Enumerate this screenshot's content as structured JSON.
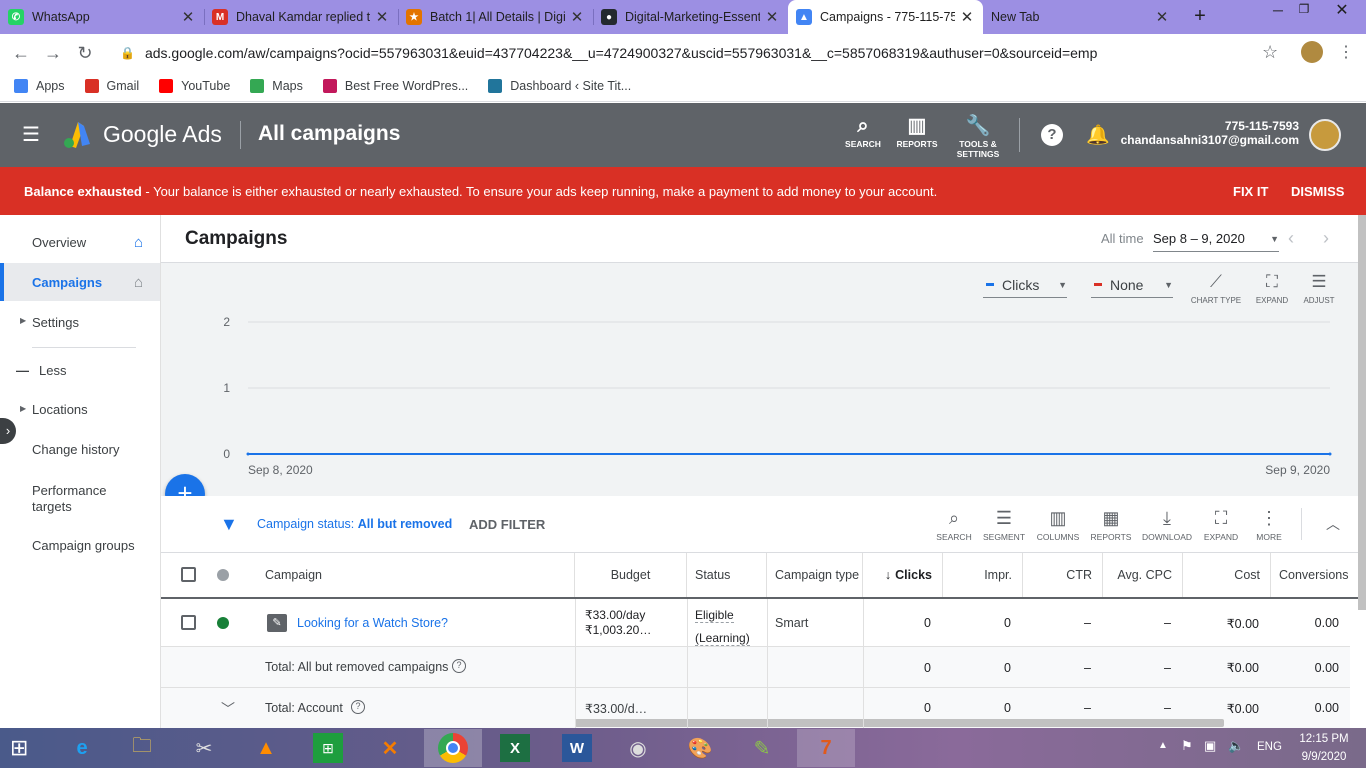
{
  "browser": {
    "tabs": [
      {
        "title": "WhatsApp",
        "color": "#25d366",
        "glyph": "✆"
      },
      {
        "title": "Dhaval Kamdar replied t",
        "color": "#d93025",
        "glyph": "M"
      },
      {
        "title": "Batch 1| All Details | Digi",
        "color": "#e37400",
        "glyph": "★"
      },
      {
        "title": "Digital-Marketing-Essent",
        "color": "#24292e",
        "glyph": "●"
      },
      {
        "title": "Campaigns - 775-115-75",
        "color": "#4285f4",
        "glyph": "▲"
      },
      {
        "title": "New Tab",
        "color": "",
        "glyph": ""
      }
    ],
    "new_tab": "+",
    "url": "ads.google.com/aw/campaigns?ocid=557963031&euid=437704223&__u=4724900327&uscid=557963031&__c=5857068319&authuser=0&sourceid=emp",
    "bookmarks": [
      {
        "label": "Apps",
        "color": "#4285f4"
      },
      {
        "label": "Gmail",
        "color": "#d93025"
      },
      {
        "label": "YouTube",
        "color": "#ff0000"
      },
      {
        "label": "Maps",
        "color": "#34a853"
      },
      {
        "label": "Best Free WordPres...",
        "color": "#c2185b"
      },
      {
        "label": "Dashboard ‹ Site Tit...",
        "color": "#21759b"
      }
    ]
  },
  "ads": {
    "brand": "Google Ads",
    "page": "All campaigns",
    "header_buttons": [
      {
        "label": "SEARCH",
        "icon": "search-icon",
        "glyph": "⌕"
      },
      {
        "label": "REPORTS",
        "icon": "reports-icon",
        "glyph": "▥"
      },
      {
        "label": "TOOLS & SETTINGS",
        "icon": "wrench-icon",
        "glyph": "🔧"
      }
    ],
    "account_id": "775-115-7593",
    "account_email": "chandansahni3107@gmail.com",
    "banner": {
      "bold": "Balance exhausted",
      "text": " - Your balance is either exhausted or nearly exhausted. To ensure your ads keep running, make a payment to add money to your account.",
      "fix": "FIX IT",
      "dismiss": "DISMISS"
    },
    "sidebar": [
      {
        "label": "Overview",
        "name": "sidebar-item-overview"
      },
      {
        "label": "Campaigns",
        "name": "sidebar-item-campaigns"
      },
      {
        "label": "Settings",
        "name": "sidebar-item-settings"
      },
      {
        "label": "Less",
        "name": "sidebar-item-less"
      },
      {
        "label": "Locations",
        "name": "sidebar-item-locations"
      },
      {
        "label": "Change history",
        "name": "sidebar-item-change-history"
      },
      {
        "label": "Performance targets",
        "name": "sidebar-item-performance-targets"
      },
      {
        "label": "Campaign groups",
        "name": "sidebar-item-campaign-groups"
      }
    ],
    "title": "Campaigns",
    "date_label": "All time",
    "date_range": "Sep 8 – 9, 2020",
    "metric1": "Clicks",
    "metric2": "None",
    "chart_tools": [
      "CHART TYPE",
      "EXPAND",
      "ADJUST"
    ],
    "filter_label": "Campaign status: ",
    "filter_value": "All but removed",
    "add_filter": "ADD FILTER",
    "table_tools": [
      "SEARCH",
      "SEGMENT",
      "COLUMNS",
      "REPORTS",
      "DOWNLOAD",
      "EXPAND",
      "MORE"
    ],
    "columns": [
      "Campaign",
      "Budget",
      "Status",
      "Campaign type",
      "Clicks",
      "Impr.",
      "CTR",
      "Avg. CPC",
      "Cost",
      "Conversions"
    ],
    "row": {
      "campaign": "Looking for a Watch Store?",
      "budget1": "₹33.00/day",
      "budget2": "₹1,003.20…",
      "status1": "Eligible",
      "status2": "(Learning)",
      "type": "Smart",
      "clicks": "0",
      "impr": "0",
      "ctr": "–",
      "cpc": "–",
      "cost": "₹0.00",
      "conv": "0.00"
    },
    "total1": {
      "label": "Total: All but removed campaigns",
      "clicks": "0",
      "impr": "0",
      "ctr": "–",
      "cpc": "–",
      "cost": "₹0.00",
      "conv": "0.00"
    },
    "total2": {
      "label": "Total: Account",
      "budget": "₹33.00/d…",
      "clicks": "0",
      "impr": "0",
      "ctr": "–",
      "cpc": "–",
      "cost": "₹0.00",
      "conv": "0.00"
    }
  },
  "chart_data": {
    "type": "line",
    "x": [
      "Sep 8, 2020",
      "Sep 9, 2020"
    ],
    "series": [
      {
        "name": "Clicks",
        "values": [
          0,
          0
        ],
        "color": "#1a73e8"
      }
    ],
    "ylim": [
      0,
      2
    ],
    "yticks": [
      "2",
      "1",
      "0"
    ],
    "xticks": [
      "Sep 8, 2020",
      "Sep 9, 2020"
    ],
    "grid": true
  },
  "taskbar": {
    "time": "12:15 PM",
    "date": "9/9/2020",
    "lang": "ENG"
  }
}
